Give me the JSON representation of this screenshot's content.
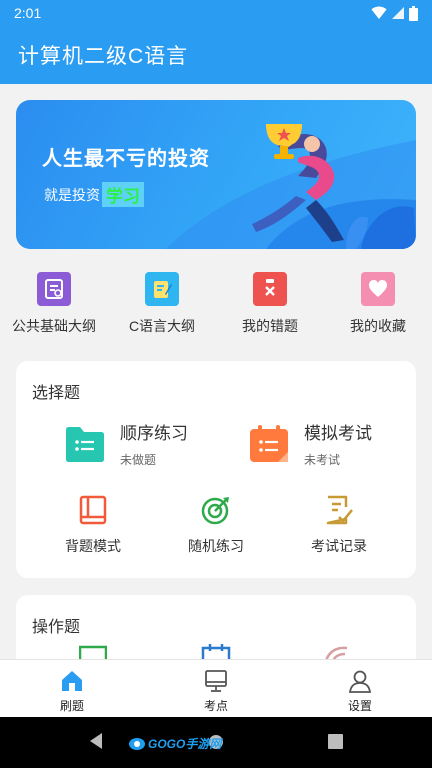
{
  "status": {
    "time": "2:01"
  },
  "appbar": {
    "title": "计算机二级C语言"
  },
  "banner": {
    "title": "人生最不亏的投资",
    "subtitle_prefix": "就是投资",
    "subtitle_highlight": "学习"
  },
  "quick_links": [
    {
      "label": "公共基础大纲",
      "icon": "outline-list-icon",
      "color": "#8b5cd6"
    },
    {
      "label": "C语言大纲",
      "icon": "outline-edit-icon",
      "color": "#2fb6f0"
    },
    {
      "label": "我的错题",
      "icon": "clipboard-x-icon",
      "color": "#ef5350"
    },
    {
      "label": "我的收藏",
      "icon": "heart-icon",
      "color": "#f48fb1"
    }
  ],
  "choice": {
    "title": "选择题",
    "sequential": {
      "title": "顺序练习",
      "sub": "未做题"
    },
    "mock": {
      "title": "模拟考试",
      "sub": "未考试"
    },
    "actions": [
      {
        "label": "背题模式",
        "icon": "book-icon",
        "color": "#f25b3a"
      },
      {
        "label": "随机练习",
        "icon": "target-icon",
        "color": "#2eaa4a"
      },
      {
        "label": "考试记录",
        "icon": "record-icon",
        "color": "#c79a36"
      }
    ]
  },
  "operation": {
    "title": "操作题"
  },
  "tabs": [
    {
      "label": "刷题",
      "icon": "home-icon",
      "active": true
    },
    {
      "label": "考点",
      "icon": "monitor-icon",
      "active": false
    },
    {
      "label": "设置",
      "icon": "user-icon",
      "active": false
    }
  ],
  "watermark": {
    "text": "GOGO手游网"
  },
  "colors": {
    "primary": "#2a9df2",
    "background": "#f2f2f2"
  }
}
